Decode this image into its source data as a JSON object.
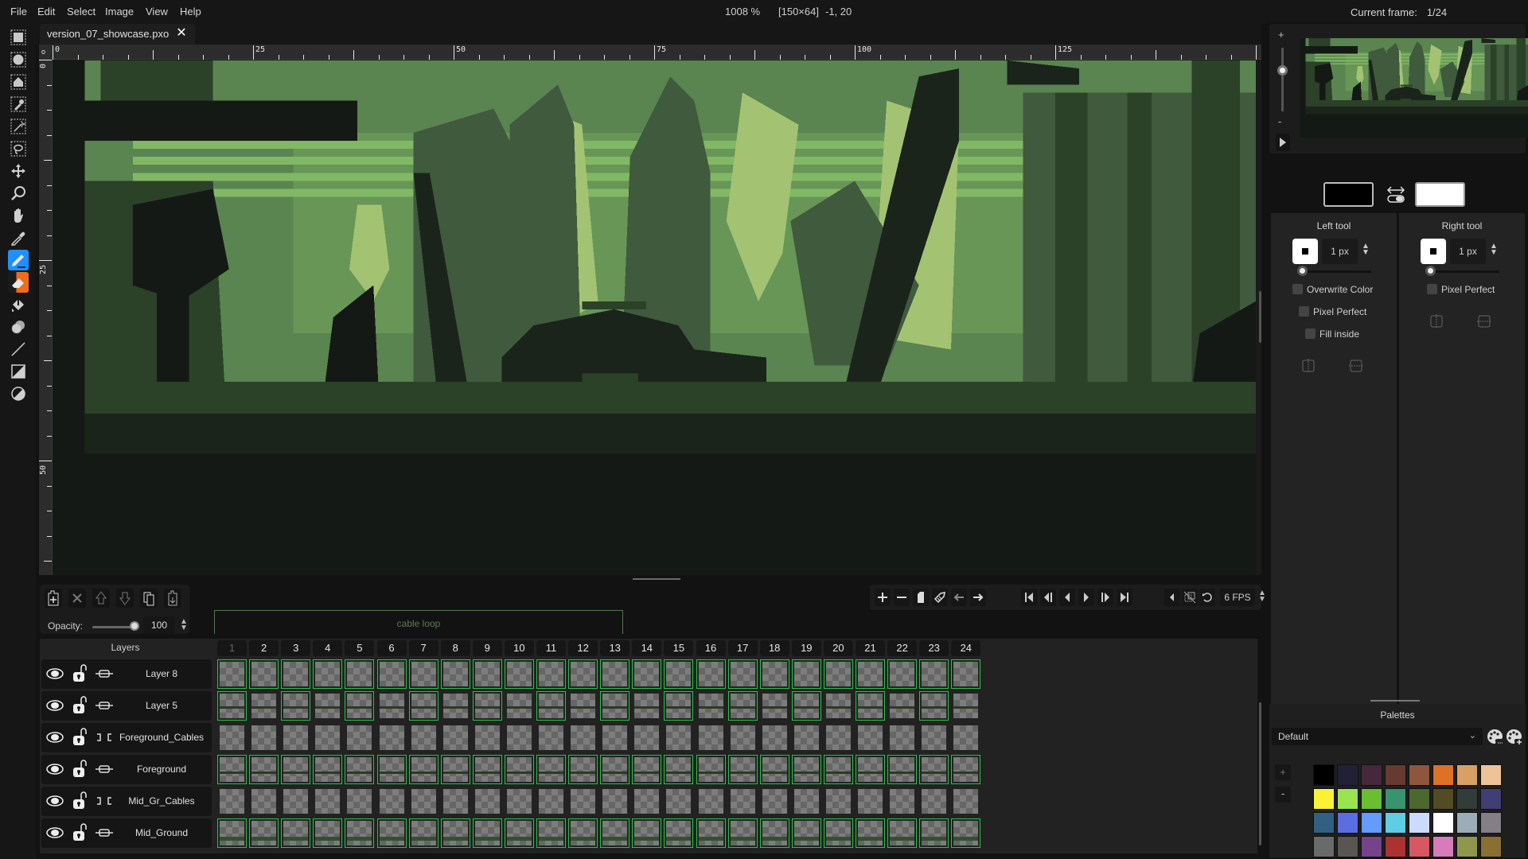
{
  "menu": [
    "File",
    "Edit",
    "Select",
    "Image",
    "View",
    "Help"
  ],
  "status": {
    "zoom": "1008 %",
    "canvas_size": "[150×64]",
    "cursor_position": "-1, 20",
    "current_frame_label": "Current frame:",
    "current_frame_value": "1/24"
  },
  "tools": [
    {
      "name": "rectangle-select",
      "active": false
    },
    {
      "name": "ellipse-select",
      "active": false
    },
    {
      "name": "polygon-select",
      "active": false
    },
    {
      "name": "select-by-color",
      "active": false
    },
    {
      "name": "magic-wand",
      "active": false
    },
    {
      "name": "lasso",
      "active": false
    },
    {
      "name": "move",
      "active": false
    },
    {
      "name": "zoom",
      "active": false
    },
    {
      "name": "pan",
      "active": false
    },
    {
      "name": "color-picker",
      "active": false
    },
    {
      "name": "pencil",
      "active": "left"
    },
    {
      "name": "eraser",
      "active": "right"
    },
    {
      "name": "bucket",
      "active": false
    },
    {
      "name": "shading",
      "active": false
    },
    {
      "name": "line",
      "active": false
    },
    {
      "name": "rectangle",
      "active": false
    },
    {
      "name": "ellipse",
      "active": false
    }
  ],
  "tab": {
    "filename": "version_07_showcase.pxo",
    "close": "✕"
  },
  "rulers": {
    "horizontal_labels": [
      "0",
      "25",
      "50",
      "75",
      "100",
      "125"
    ],
    "vertical_labels": [
      "0",
      "25",
      "50"
    ],
    "corner": "o"
  },
  "timeline": {
    "opacity_label": "Opacity:",
    "opacity_value": "100",
    "opacity": 100,
    "tag": {
      "name": "cable loop",
      "from_frame": 1,
      "to_frame": 12
    },
    "layers_header": "Layers",
    "frame_count": 24,
    "current_frame": 1,
    "fps": "6 FPS",
    "layer_buttons": [
      "add-layer",
      "remove-layer",
      "move-layer-up",
      "move-layer-down",
      "clone-layer",
      "merge-down"
    ],
    "frame_buttons": [
      "add-frame",
      "remove-frame",
      "clone-frame",
      "frame-tag",
      "move-frame-left",
      "move-frame-right"
    ],
    "playback_buttons": [
      "jump-to-first",
      "previous-frame",
      "play-backwards",
      "play-forward",
      "next-frame",
      "jump-to-last"
    ],
    "extra_buttons": [
      "onion-skin-settings",
      "onion-skinning",
      "loop"
    ],
    "layers": [
      {
        "name": "Layer 8",
        "visible": true,
        "locked": false,
        "linked": true,
        "linked_cels": "all"
      },
      {
        "name": "Layer 5",
        "visible": true,
        "locked": false,
        "linked": true,
        "linked_cels": "odd"
      },
      {
        "name": "Foreground_Cables",
        "visible": true,
        "locked": false,
        "linked": false,
        "linked_cels": "none"
      },
      {
        "name": "Foreground",
        "visible": true,
        "locked": false,
        "linked": true,
        "linked_cels": "all"
      },
      {
        "name": "Mid_Gr_Cables",
        "visible": true,
        "locked": false,
        "linked": false,
        "linked_cels": "none"
      },
      {
        "name": "Mid_Ground",
        "visible": true,
        "locked": false,
        "linked": true,
        "linked_cels": "all"
      }
    ]
  },
  "colors": {
    "left": "#000000",
    "right": "#ffffff",
    "accent_link": "#2ec04a",
    "art": [
      "#151915",
      "#1b241a",
      "#2b4128",
      "#3f5a3c",
      "#5a8450",
      "#82b865",
      "#a3c373"
    ]
  },
  "left_tool": {
    "title": "Left tool",
    "brush_size": "1 px",
    "options": [
      {
        "label": "Overwrite Color",
        "checked": false
      },
      {
        "label": "Pixel Perfect",
        "checked": false
      },
      {
        "label": "Fill inside",
        "checked": false
      }
    ]
  },
  "right_tool": {
    "title": "Right tool",
    "brush_size": "1 px",
    "options": [
      {
        "label": "Pixel Perfect",
        "checked": false
      }
    ]
  },
  "palettes": {
    "title": "Palettes",
    "selected": "Default",
    "add": "+",
    "remove": "-",
    "swatches": [
      "#000000",
      "#222034",
      "#45283c",
      "#663931",
      "#8f563b",
      "#df7126",
      "#d9a066",
      "#eec39a",
      "#fbf236",
      "#99e550",
      "#6abe30",
      "#37946e",
      "#4b692f",
      "#524b24",
      "#323c39",
      "#3f3f74",
      "#306082",
      "#5b6ee1",
      "#639bff",
      "#5fcde4",
      "#cbdbfc",
      "#ffffff",
      "#9badb7",
      "#847e87",
      "#696a6a",
      "#595652",
      "#76428a",
      "#ac3232",
      "#d95763",
      "#d77bba",
      "#8f974a",
      "#8a6f30"
    ]
  }
}
